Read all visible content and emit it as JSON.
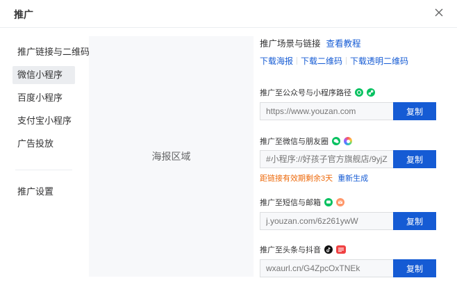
{
  "header": {
    "title": "推广"
  },
  "nav": {
    "items": [
      "推广链接与二维码",
      "微信小程序",
      "百度小程序",
      "支付宝小程序",
      "广告投放"
    ],
    "settings": "推广设置"
  },
  "poster": {
    "label": "海报区域"
  },
  "scene": {
    "title": "推广场景与链接",
    "tutorial": "查看教程",
    "downloads": [
      "下载海报",
      "下载二维码",
      "下载透明二维码"
    ]
  },
  "sections": {
    "mp": {
      "label": "推广至公众号与小程序路径",
      "placeholder": "https://www.youzan.com",
      "button": "复制",
      "icons": [
        "wechat-official-icon",
        "link-icon"
      ]
    },
    "moments": {
      "label": "推广至微信与朋友圈",
      "placeholder": "#小程序://好孩子官方旗舰店/9yjZ",
      "button": "复制",
      "icons": [
        "wechat-icon",
        "moments-icon"
      ]
    },
    "sms": {
      "label": "推广至短信与邮箱",
      "placeholder": "j.youzan.com/6z261ywW",
      "button": "复制",
      "icons": [
        "sms-icon",
        "mail-icon"
      ]
    },
    "toutiao": {
      "label": "推广至头条与抖音",
      "placeholder": "wxaurl.cn/G4ZpcOxTNEk",
      "button": "复制",
      "icons": [
        "douyin-icon",
        "toutiao-icon"
      ]
    }
  },
  "expiry": {
    "warning": "距链接有效期剩余3天",
    "regenerate": "重新生成"
  },
  "colors": {
    "primary": "#155bd4",
    "warning": "#ed6a0c",
    "wechat": "#07c160"
  }
}
